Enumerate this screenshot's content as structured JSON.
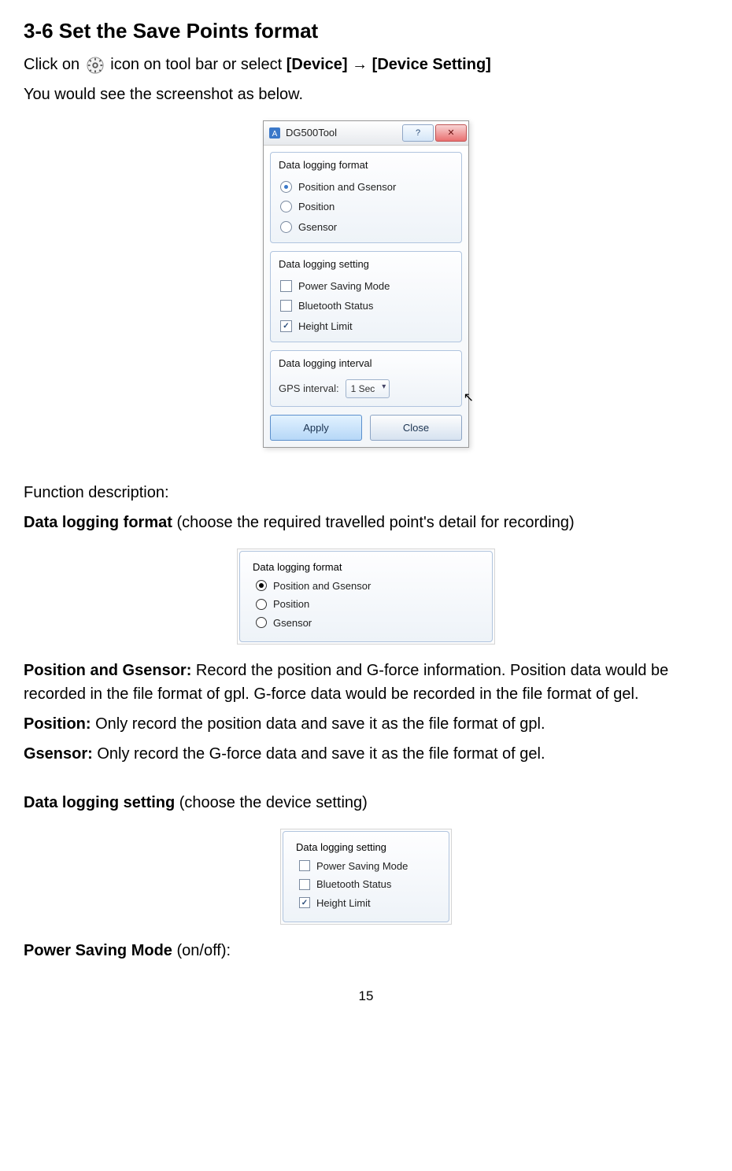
{
  "heading": "3-6 Set the Save Points format",
  "intro": {
    "line1a": "Click on ",
    "line1b": " icon on tool bar or select ",
    "menu_device": "[Device]",
    "arrow": " → ",
    "menu_device_setting": "[Device Setting]",
    "line2": "You would see the screenshot as below."
  },
  "dialog": {
    "title": "DG500Tool",
    "group_format_title": "Data logging format",
    "opt_position_gsensor": "Position and Gsensor",
    "opt_position": "Position",
    "opt_gsensor": "Gsensor",
    "group_setting_title": "Data logging setting",
    "chk_power_saving": "Power Saving Mode",
    "chk_bluetooth": "Bluetooth Status",
    "chk_height_limit": "Height Limit",
    "group_interval_title": "Data logging interval",
    "interval_label": "GPS interval:",
    "interval_value": "1 Sec",
    "btn_apply": "Apply",
    "btn_close": "Close",
    "tb_help": "?",
    "tb_close": "✕"
  },
  "function_description_label": "Function description:",
  "dlf_heading": "Data logging format",
  "dlf_heading_suffix": " (choose the required travelled point's detail for recording)",
  "snippet_format": {
    "title": "Data logging format",
    "opt1": "Position and Gsensor",
    "opt2": "Position",
    "opt3": "Gsensor"
  },
  "desc_pg_bold": "Position and Gsensor:",
  "desc_pg_text": " Record the position and G-force information. Position data would be recorded in the file format of gpl. G-force data would be recorded in the file format of gel.",
  "desc_p_bold": "Position:",
  "desc_p_text": " Only record the position data and save it as the file format of gpl.",
  "desc_g_bold": "Gsensor:",
  "desc_g_text": " Only record the G-force data and save it as the file format of gel.",
  "dls_heading": "Data logging setting",
  "dls_heading_suffix": " (choose the device setting)",
  "snippet_setting": {
    "title": "Data logging setting",
    "chk1": "Power Saving Mode",
    "chk2": "Bluetooth Status",
    "chk3": "Height Limit"
  },
  "psm_bold": "Power Saving Mode",
  "psm_suffix": " (on/off):",
  "page_number": "15"
}
